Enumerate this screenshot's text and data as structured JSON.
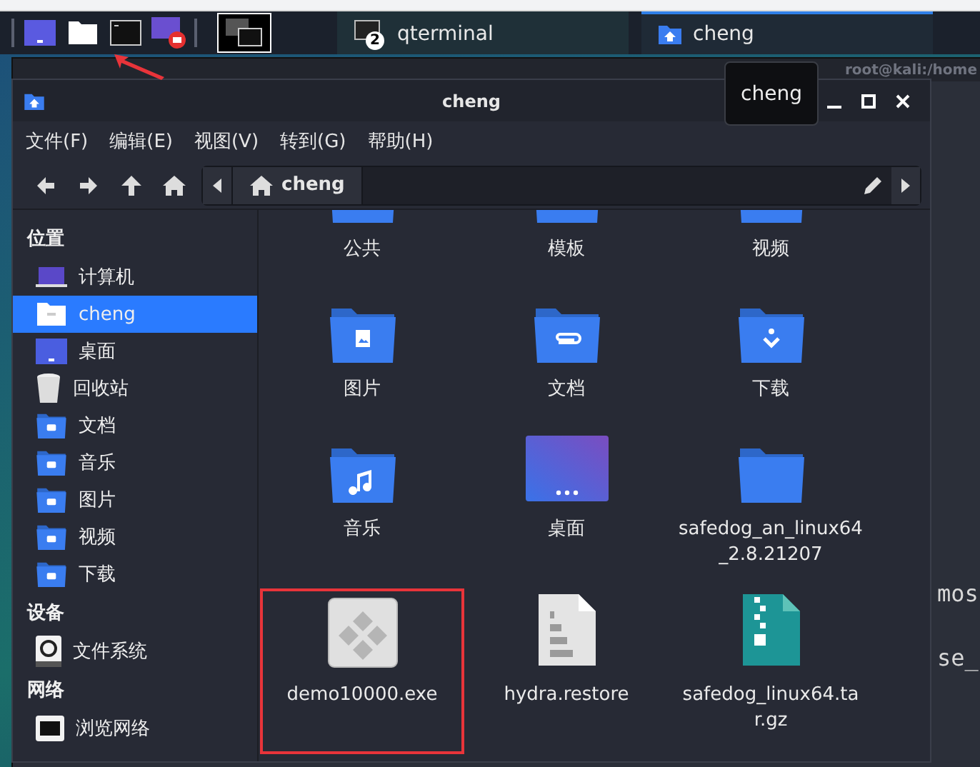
{
  "taskbar": {
    "launchers": [
      {
        "kind": "desktop"
      },
      {
        "kind": "files"
      },
      {
        "kind": "terminal"
      },
      {
        "kind": "recorder"
      }
    ],
    "tasks": [
      {
        "label": "qterminal",
        "badge": "2",
        "kind": "terminal",
        "selected": false
      },
      {
        "label": "cheng",
        "kind": "home",
        "selected": true
      }
    ]
  },
  "background_terminal": {
    "title": "root@kali:/home",
    "lines": [
      "mos",
      "se_"
    ]
  },
  "tooltip": "cheng",
  "window": {
    "title": "cheng",
    "menu": [
      "文件(F)",
      "编辑(E)",
      "视图(V)",
      "转到(G)",
      "帮助(H)"
    ],
    "path": {
      "crumbs": [
        {
          "label": "cheng",
          "selected": true
        }
      ]
    },
    "sidebar": [
      {
        "title": "位置",
        "items": [
          {
            "label": "计算机",
            "kind": "computer",
            "selected": false
          },
          {
            "label": "cheng",
            "kind": "home",
            "selected": true
          },
          {
            "label": "桌面",
            "kind": "desktop",
            "selected": false
          },
          {
            "label": "回收站",
            "kind": "trash",
            "selected": false
          },
          {
            "label": "文档",
            "kind": "documents",
            "selected": false
          },
          {
            "label": "音乐",
            "kind": "music",
            "selected": false
          },
          {
            "label": "图片",
            "kind": "pictures",
            "selected": false
          },
          {
            "label": "视频",
            "kind": "videos",
            "selected": false
          },
          {
            "label": "下载",
            "kind": "downloads",
            "selected": false
          }
        ]
      },
      {
        "title": "设备",
        "items": [
          {
            "label": "文件系统",
            "kind": "drive",
            "selected": false
          }
        ]
      },
      {
        "title": "网络",
        "items": [
          {
            "label": "浏览网络",
            "kind": "network",
            "selected": false
          }
        ]
      }
    ],
    "files": [
      {
        "label": "公共",
        "kind": "folder",
        "outlined": false
      },
      {
        "label": "模板",
        "kind": "folder",
        "outlined": false
      },
      {
        "label": "视频",
        "kind": "folder",
        "outlined": false
      },
      {
        "label": "图片",
        "kind": "pictures",
        "outlined": false
      },
      {
        "label": "文档",
        "kind": "documents",
        "outlined": false
      },
      {
        "label": "下载",
        "kind": "downloads",
        "outlined": false
      },
      {
        "label": "音乐",
        "kind": "music",
        "outlined": false
      },
      {
        "label": "桌面",
        "kind": "desktop",
        "outlined": false
      },
      {
        "label": "safedog_an_linux64_2.8.21207",
        "kind": "folder",
        "outlined": false
      },
      {
        "label": "demo10000.exe",
        "kind": "executable",
        "outlined": true
      },
      {
        "label": "hydra.restore",
        "kind": "binary",
        "outlined": false
      },
      {
        "label": "safedog_linux64.tar.gz",
        "kind": "archive",
        "outlined": false
      }
    ]
  }
}
